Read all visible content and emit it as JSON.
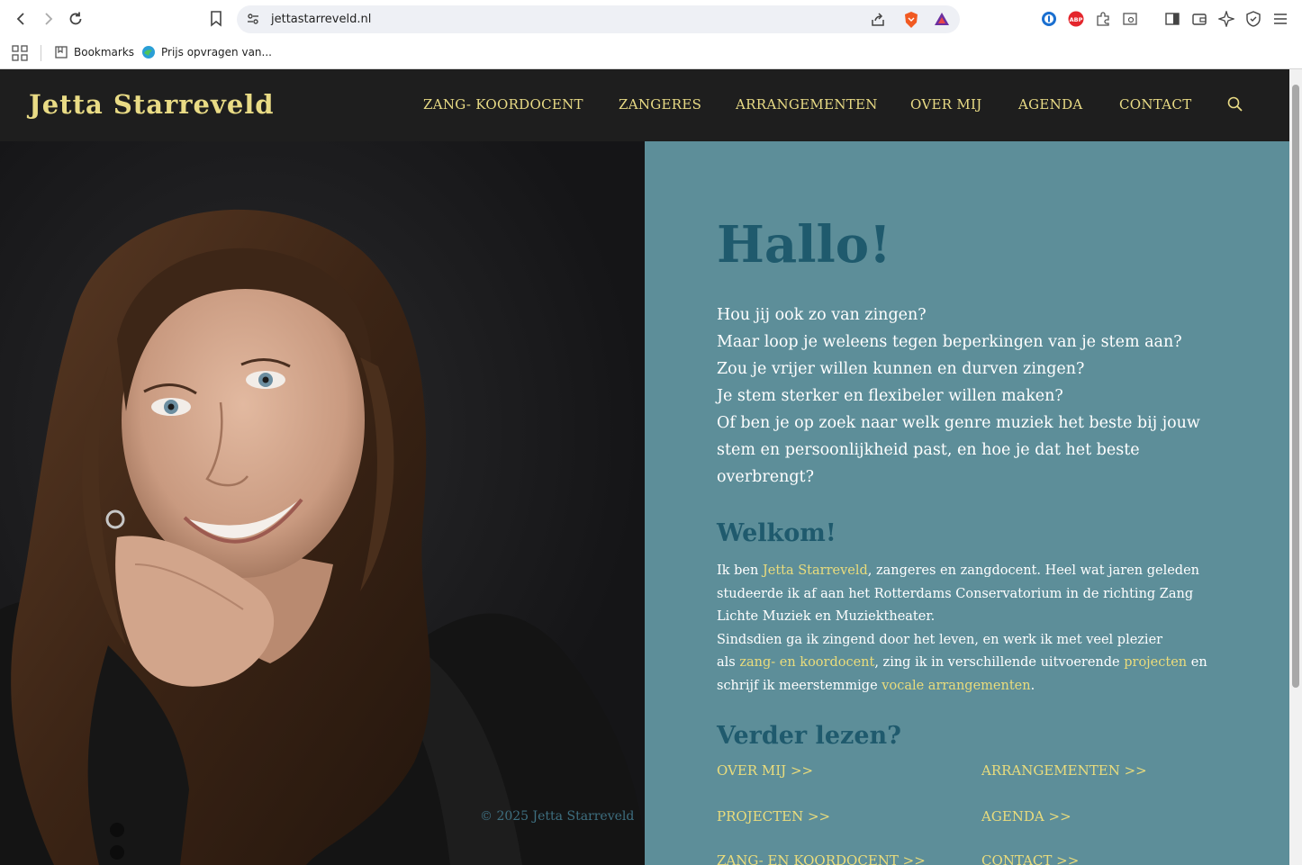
{
  "browser": {
    "url": "jettastarreveld.nl",
    "bookmarks": [
      {
        "label": "Bookmarks"
      },
      {
        "label": "Prijs opvragen van..."
      }
    ]
  },
  "site": {
    "logo": "Jetta Starreveld",
    "menu": [
      {
        "label": "ZANG- KOORDOCENT"
      },
      {
        "label": "ZANGERES"
      },
      {
        "label": "ARRANGEMENTEN"
      },
      {
        "label": "OVER MIJ"
      },
      {
        "label": "AGENDA"
      },
      {
        "label": "CONTACT"
      }
    ],
    "copyright": "© 2025 Jetta Starreveld",
    "hero_title": "Hallo!",
    "intro_lines": [
      "Hou jij ook zo van zingen?",
      "Maar loop je weleens tegen beperkingen van je stem aan?",
      "Zou je vrijer willen kunnen en durven zingen?",
      "Je stem sterker en flexibeler willen maken?",
      "Of ben je op zoek naar welk genre muziek het beste bij jouw",
      "stem en persoonlijkheid past, en hoe je dat het beste",
      "overbrengt?"
    ],
    "welcome": {
      "title": "Welkom!",
      "l1_pre": "Ik ben ",
      "l1_link": "Jetta Starreveld",
      "l1_post": ", zangeres en zangdocent. Heel wat jaren geleden",
      "l2": "studeerde ik af aan het Rotterdams Conservatorium in de richting Zang",
      "l3": "Lichte Muziek en Muziektheater.",
      "l4": "Sindsdien ga ik zingend door het leven, en werk ik met veel plezier",
      "l5_pre": "als ",
      "l5_link1": "zang- en koordocent",
      "l5_mid": ", zing ik in verschillende uitvoerende ",
      "l5_link2": "projecten",
      "l5_post": " en",
      "l6_pre": "schrijf ik meerstemmige ",
      "l6_link": "vocale arrangementen",
      "l6_post": "."
    },
    "read_more": {
      "title": "Verder lezen?",
      "links": [
        {
          "label": "OVER MIJ >>"
        },
        {
          "label": "ARRANGEMENTEN >>"
        },
        {
          "label": "PROJECTEN >>"
        },
        {
          "label": "AGENDA >>"
        },
        {
          "label": "ZANG- EN KOORDOCENT >>"
        },
        {
          "label": "CONTACT >>"
        }
      ]
    },
    "colors": {
      "header_bg": "#1e1e1e",
      "accent_gold": "#e9db85",
      "panel_teal": "#5d8e99",
      "heading_teal": "#1f5a6d"
    }
  }
}
